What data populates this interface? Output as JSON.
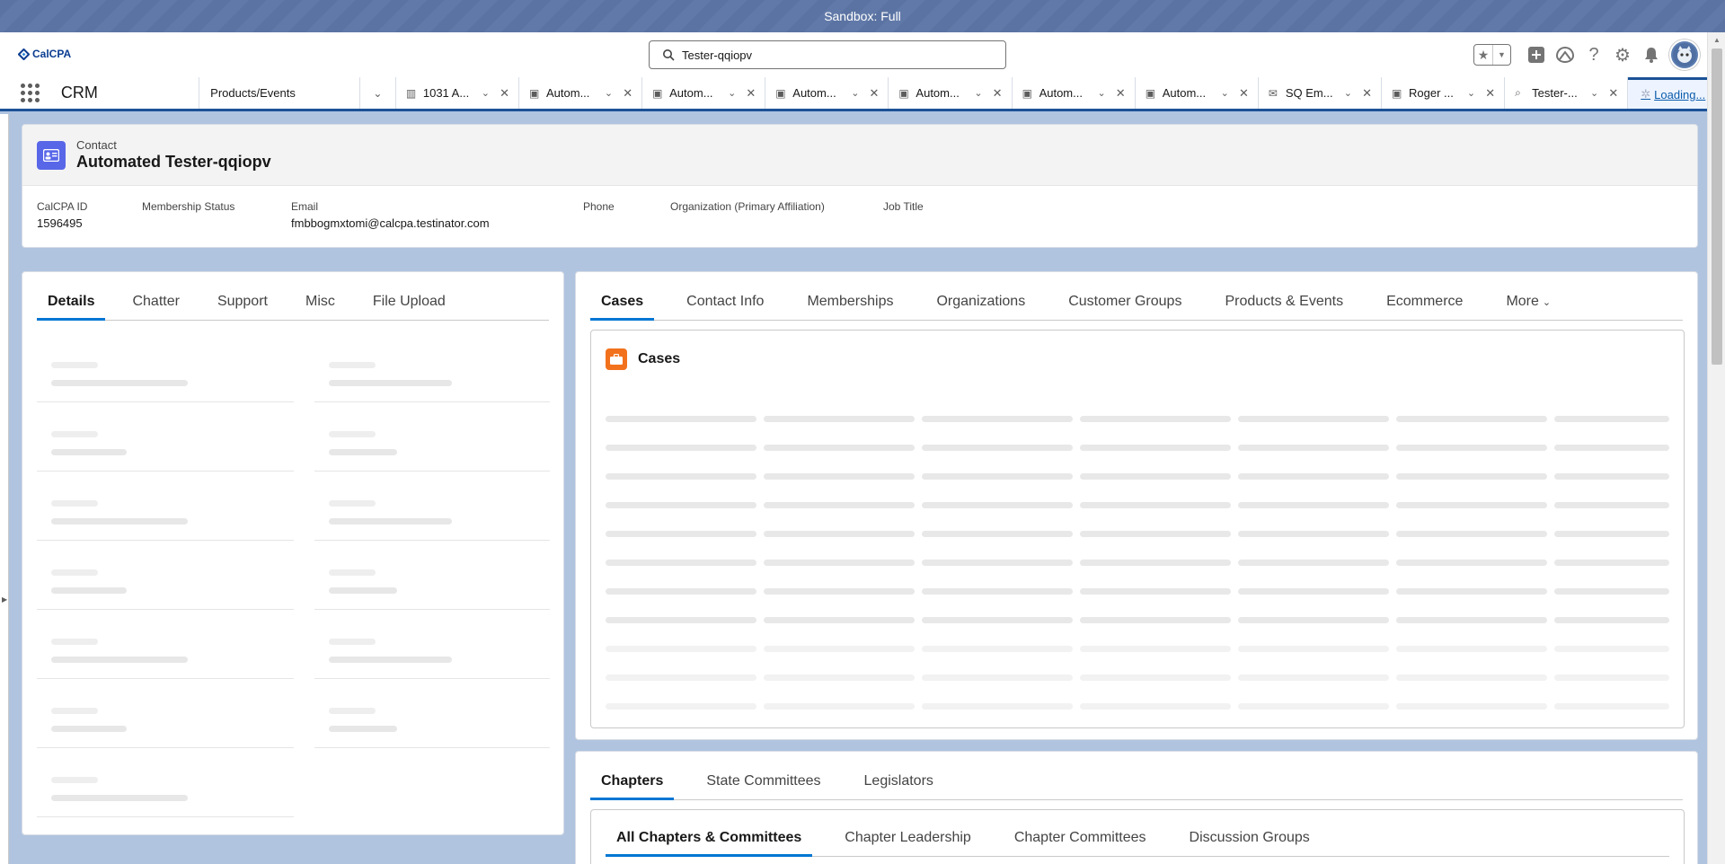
{
  "sandbox": {
    "label": "Sandbox: Full"
  },
  "header": {
    "logo_text": "CalCPA",
    "search_value": "Tester-qqiopv",
    "icons": [
      "favorites-star-icon",
      "chevron-down-icon",
      "add-icon",
      "trailhead-icon",
      "help-icon",
      "setup-gear-icon",
      "notifications-bell-icon",
      "avatar"
    ]
  },
  "nav": {
    "app_name": "CRM",
    "object_select": "Products/Events",
    "tabs": [
      {
        "icon": "▥",
        "label": "1031 A..."
      },
      {
        "icon": "▣",
        "label": "Autom..."
      },
      {
        "icon": "▣",
        "label": "Autom..."
      },
      {
        "icon": "▣",
        "label": "Autom..."
      },
      {
        "icon": "▣",
        "label": "Autom..."
      },
      {
        "icon": "▣",
        "label": "Autom..."
      },
      {
        "icon": "▣",
        "label": "Autom..."
      },
      {
        "icon": "✉",
        "label": "SQ Em..."
      },
      {
        "icon": "▣",
        "label": "Roger ..."
      },
      {
        "icon": "⌕",
        "label": "Tester-..."
      }
    ],
    "loading_label": "Loading..."
  },
  "record": {
    "type": "Contact",
    "name": "Automated Tester-qqiopv",
    "fields": [
      {
        "label": "CalCPA ID",
        "value": "1596495"
      },
      {
        "label": "Membership Status",
        "value": ""
      },
      {
        "label": "Email",
        "value": "fmbbogmxtomi@calcpa.testinator.com"
      },
      {
        "label": "Phone",
        "value": ""
      },
      {
        "label": "Organization (Primary Affiliation)",
        "value": ""
      },
      {
        "label": "Job Title",
        "value": ""
      }
    ]
  },
  "left_tabs": [
    "Details",
    "Chatter",
    "Support",
    "Misc",
    "File Upload"
  ],
  "left_active": "Details",
  "right_tabs": [
    "Cases",
    "Contact Info",
    "Memberships",
    "Organizations",
    "Customer Groups",
    "Products & Events",
    "Ecommerce",
    "More"
  ],
  "cases_card": {
    "title": "Cases"
  },
  "bottom_tabs": [
    "Chapters",
    "State Committees",
    "Legislators"
  ],
  "sub_tabs": [
    "All Chapters & Committees",
    "Chapter Leadership",
    "Chapter Committees",
    "Discussion Groups"
  ],
  "colors": {
    "brand_blue": "#1b5297",
    "active_tab": "#0176d3",
    "contact_icon": "#5867e8",
    "cases_icon": "#f2711c"
  }
}
